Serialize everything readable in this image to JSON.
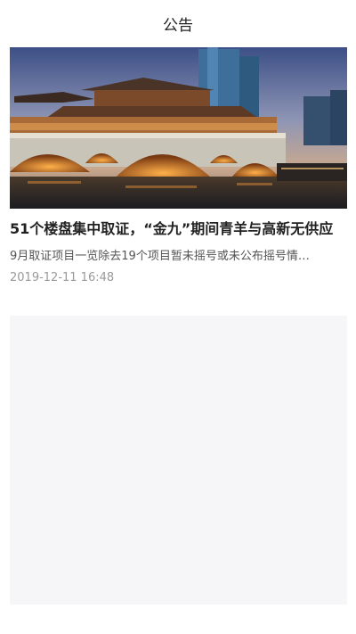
{
  "header": {
    "title": "公告"
  },
  "article": {
    "title": "51个楼盘集中取证，“金九”期间青羊与高新无供应",
    "summary": "9月取证项目一览除去19个项目暂未摇号或未公布摇号情况",
    "summary_display": "9月取证项目一览除去19个项目暂未摇号或未公布摇号情…",
    "date": "2019-12-11 16:48"
  }
}
